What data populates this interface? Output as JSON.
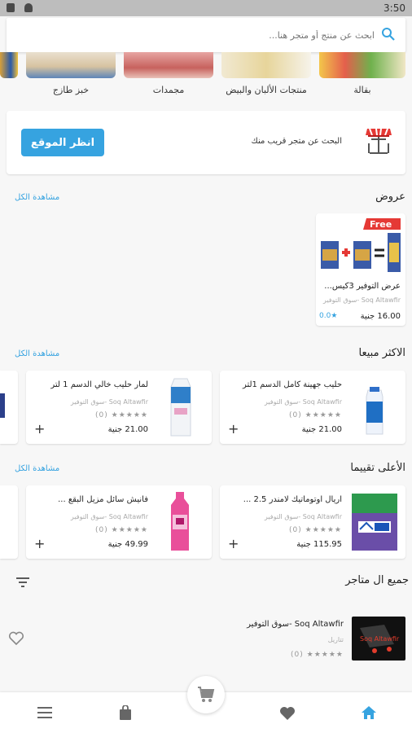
{
  "status_bar": {
    "time": "3:50"
  },
  "search": {
    "placeholder": "ابحث عن منتج أو متجر هنا..."
  },
  "categories": [
    {
      "label": "بقالة"
    },
    {
      "label": "منتجات الألبان والبيض"
    },
    {
      "label": "مجمدات"
    },
    {
      "label": "خبز طازج"
    }
  ],
  "location": {
    "text": "البحث عن متجر قريب منك",
    "button_label": "انظر الموقع"
  },
  "offers": {
    "title": "عروض",
    "see_all": "مشاهدة الكل",
    "items": [
      {
        "badge": "Free",
        "name": "عرض التوفير 3كيس...",
        "store": "Soq Altawfir -سوق التوفير",
        "price": "16.00 جنية",
        "rating": "0.0"
      }
    ]
  },
  "best_selling": {
    "title": "الاكثر مبيعا",
    "see_all": "مشاهدة الكل",
    "items": [
      {
        "name": "حليب جهينة كامل الدسم 1لتر",
        "store": "Soq Altawfir -سوق التوفير",
        "reviews": "(0)",
        "price": "21.00 جنية"
      },
      {
        "name": "لمار حليب خالي الدسم 1 لتر",
        "store": "Soq Altawfir -سوق التوفير",
        "reviews": "(0)",
        "price": "21.00 جنية"
      }
    ]
  },
  "top_rated": {
    "title": "الأعلى تقييما",
    "see_all": "مشاهدة الكل",
    "items": [
      {
        "name": "اريال اوتوماتيك لامندر 2.5 ...",
        "store": "Soq Altawfir -سوق التوفير",
        "reviews": "(0)",
        "price": "115.95 جنية"
      },
      {
        "name": "فانيش سائل مزيل البقع ...",
        "store": "Soq Altawfir -سوق التوفير",
        "reviews": "(0)",
        "price": "49.99 جنية"
      }
    ]
  },
  "stores": {
    "title": "جميع ال متاجر",
    "items": [
      {
        "name": "Soq Altawfir -سوق التوفير",
        "area": "تتاريل",
        "reviews": "(0)",
        "logo_text": "Soq Altawfir"
      }
    ]
  },
  "colors": {
    "accent": "#36a3e0"
  },
  "bottom_nav": [
    "menu-icon",
    "bag-icon",
    "heart-icon",
    "home-icon"
  ]
}
